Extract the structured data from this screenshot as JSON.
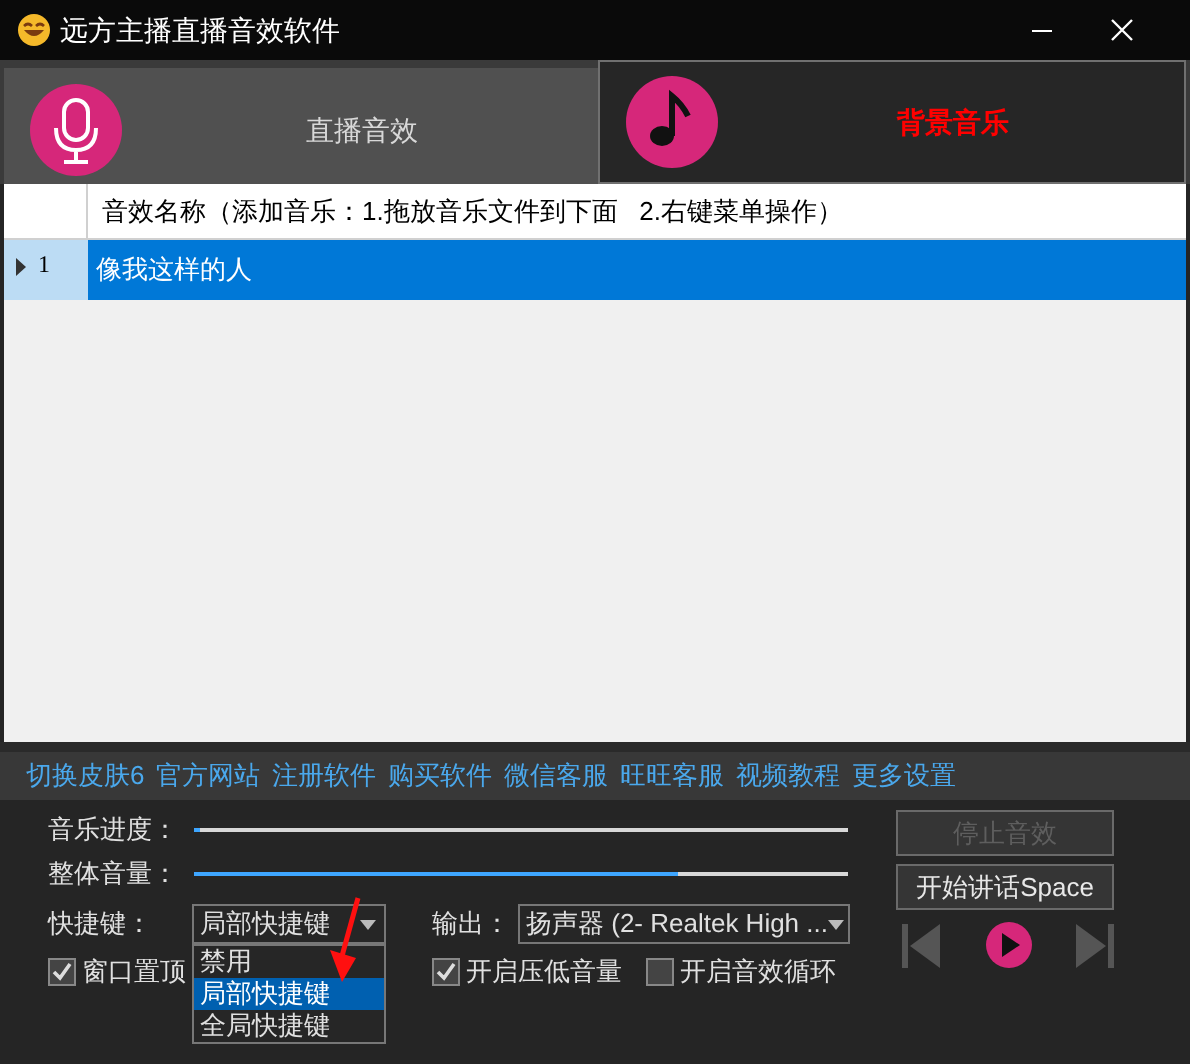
{
  "window": {
    "title": "远方主播直播音效软件"
  },
  "tabs": [
    {
      "label": "直播音效",
      "selected": false,
      "kind": "microphone"
    },
    {
      "label": "背景音乐",
      "selected": true,
      "kind": "music"
    }
  ],
  "table": {
    "header": "音效名称（添加音乐：1.拖放音乐文件到下面   2.右键菜单操作）",
    "rows": [
      {
        "number": "1",
        "name": "像我这样的人",
        "selected": true
      }
    ]
  },
  "links": [
    "切换皮肤6",
    "官方网站",
    "注册软件",
    "购买软件",
    "微信客服",
    "旺旺客服",
    "视频教程",
    "更多设置"
  ],
  "music_progress": {
    "label": "音乐进度：",
    "level": 0.01
  },
  "volume": {
    "label": "整体音量：",
    "level": 0.74
  },
  "hotkey": {
    "label": "快捷键：",
    "value": "局部快捷键",
    "expanded": true,
    "options": [
      {
        "label": "禁用",
        "selected": false
      },
      {
        "label": "局部快捷键",
        "selected": true
      },
      {
        "label": "全局快捷键",
        "selected": false
      }
    ]
  },
  "output": {
    "label": "输出：",
    "value": "扬声器 (2- Realtek High ..."
  },
  "checkboxes": [
    {
      "label": "窗口置顶",
      "checked": true
    },
    {
      "label": "开启压低音量",
      "checked": true
    },
    {
      "label": "开启音效循环",
      "checked": false
    }
  ],
  "buttons": [
    {
      "label": "停止音效",
      "disabled": true
    },
    {
      "label": "开始讲话Space",
      "disabled": false
    }
  ]
}
